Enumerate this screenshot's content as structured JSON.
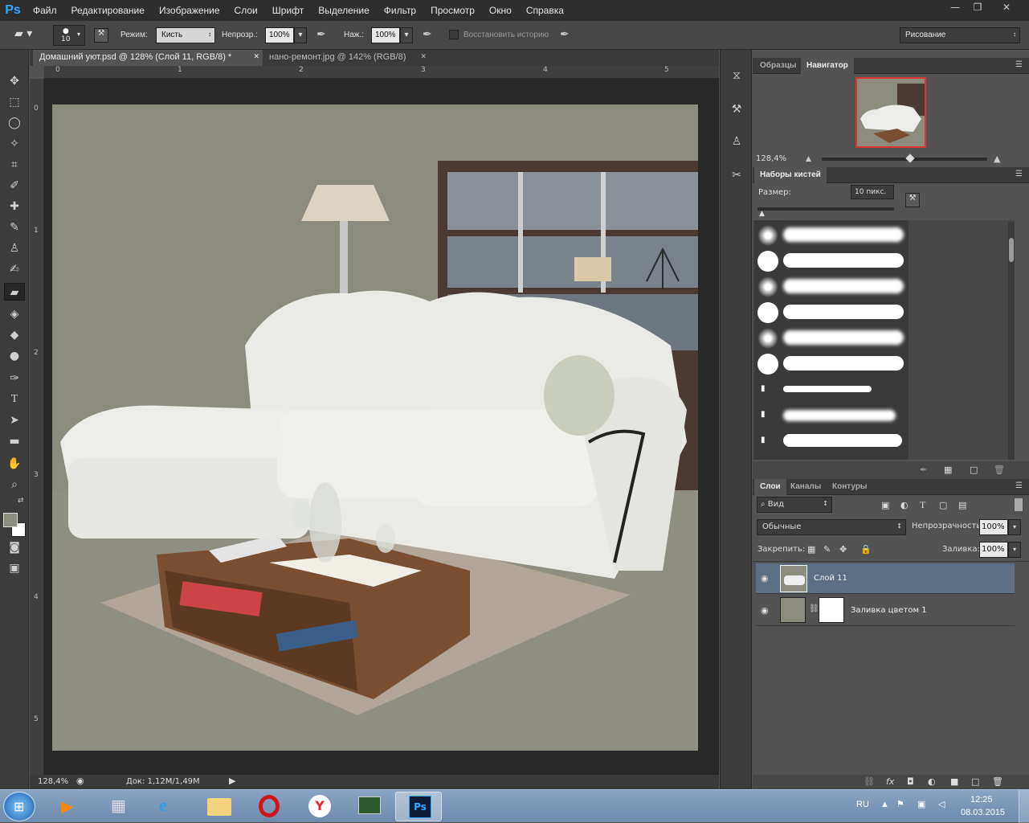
{
  "app": {
    "logo": "Ps"
  },
  "menu": [
    "Файл",
    "Редактирование",
    "Изображение",
    "Слои",
    "Шрифт",
    "Выделение",
    "Фильтр",
    "Просмотр",
    "Окно",
    "Справка"
  ],
  "options": {
    "brush_size": "10",
    "mode_label": "Режим:",
    "mode_value": "Кисть",
    "opacity_label": "Непрозр.:",
    "opacity_value": "100%",
    "flow_label": "Наж.:",
    "flow_value": "100%",
    "restore_history": "Восстановить историю",
    "workspace": "Рисование"
  },
  "tabs": [
    {
      "label": "Домашний уют.psd @ 128% (Слой 11, RGB/8) *",
      "active": true
    },
    {
      "label": "нано-ремонт.jpg @ 142% (RGB/8)",
      "active": false
    }
  ],
  "ruler_top": [
    "0",
    "1",
    "2",
    "3",
    "4",
    "5"
  ],
  "ruler_left": [
    "0",
    "1",
    "2",
    "3",
    "4",
    "5"
  ],
  "status": {
    "zoom": "128,4%",
    "doc": "Док: 1,12M/1,49M"
  },
  "navigator": {
    "tabs": [
      "Образцы",
      "Навигатор"
    ],
    "zoom": "128,4%"
  },
  "brushes": {
    "title": "Наборы кистей",
    "size_label": "Размер:",
    "size_value": "10 пикс."
  },
  "layers": {
    "tabs": [
      "Слои",
      "Каналы",
      "Контуры"
    ],
    "filter": "Вид",
    "blend": "Обычные",
    "opacity_label": "Непрозрачность:",
    "opacity_value": "100%",
    "lock_label": "Закрепить:",
    "fill_label": "Заливка:",
    "fill_value": "100%",
    "items": [
      {
        "name": "Слой 11",
        "selected": true
      },
      {
        "name": "Заливка цветом 1",
        "selected": false
      }
    ]
  },
  "taskbar": {
    "lang": "RU",
    "time": "12:25",
    "date": "08.03.2015"
  },
  "colors": {
    "accent": "#31a8ff",
    "selected_layer": "#5d6f85",
    "canvas_bg": "#8b8b7e"
  }
}
